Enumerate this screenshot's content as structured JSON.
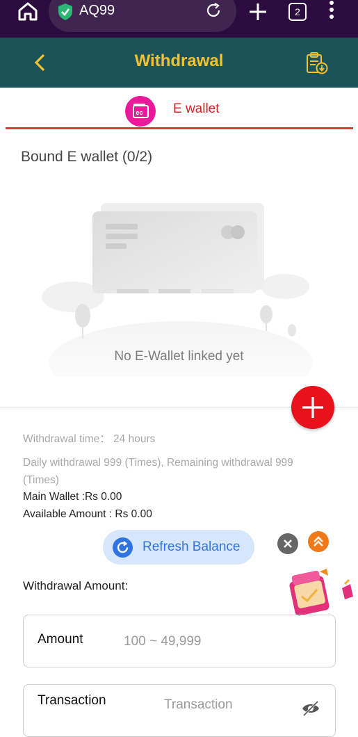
{
  "browser": {
    "url": "AQ99",
    "tab_count": "2",
    "icons": [
      "home-icon",
      "shield-check-icon",
      "reload-icon",
      "plus-icon",
      "tabs-icon",
      "more-vert-icon"
    ]
  },
  "header": {
    "title": "Withdrawal",
    "accent": "#f2c230",
    "background": "#1b5358"
  },
  "tabs": {
    "ewallet_label": "E wallet",
    "ewallet_icon_text": "ec"
  },
  "bound": {
    "title": "Bound E wallet (0/2)",
    "empty_text": "No E-Wallet linked yet"
  },
  "info": {
    "withdrawal_time": "Withdrawal time：  24 hours",
    "daily_line1": "Daily withdrawal 999 (Times), Remaining withdrawal 999",
    "daily_line2": "(Times)",
    "main_wallet": "Main Wallet :Rs 0.00",
    "available": "Available Amount : Rs 0.00"
  },
  "refresh": {
    "label": "Refresh Balance"
  },
  "form": {
    "withdrawal_amount_label": "Withdrawal Amount:",
    "amount_label": "Amount",
    "amount_placeholder": "100 ~ 49,999",
    "transaction_label": "Transaction",
    "transaction_placeholder": "Transaction"
  },
  "colors": {
    "browser_bar": "#2c0c3f",
    "tab_accent": "#d2232a",
    "add_button": "#e8121d",
    "refresh_bg": "#d7e7fb",
    "refresh_text": "#2f74e0"
  }
}
